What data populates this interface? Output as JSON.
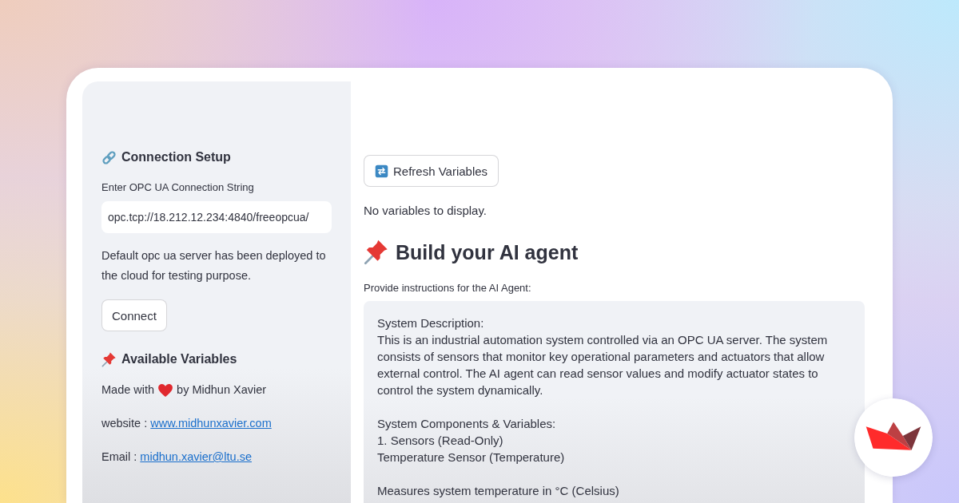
{
  "sidebar": {
    "connection": {
      "heading": "Connection Setup",
      "field_label": "Enter OPC UA Connection String",
      "field_value": "opc.tcp://18.212.12.234:4840/freeopcua/",
      "note": "Default opc ua server has been deployed to the cloud for testing purpose.",
      "button": "Connect"
    },
    "variables": {
      "heading": "Available Variables"
    },
    "credit": {
      "before": "Made with",
      "after": "by Midhun Xavier"
    },
    "links": [
      {
        "label": "website :",
        "link": "www.midhunxavier.com"
      },
      {
        "label": "Email :",
        "link": "midhun.xavier@ltu.se"
      }
    ]
  },
  "main": {
    "refresh_button": "Refresh Variables",
    "empty_message": "No variables to display.",
    "agent": {
      "heading": "Build your AI agent",
      "field_label": "Provide instructions for the AI Agent:",
      "instructions": "System Description:\nThis is an industrial automation system controlled via an OPC UA server. The system consists of sensors that monitor key operational parameters and actuators that allow external control. The AI agent can read sensor values and modify actuator states to control the system dynamically.\n\nSystem Components & Variables:\n1. Sensors (Read-Only)\nTemperature Sensor (Temperature)\n\nMeasures system temperature in °C (Celsius)"
    }
  }
}
